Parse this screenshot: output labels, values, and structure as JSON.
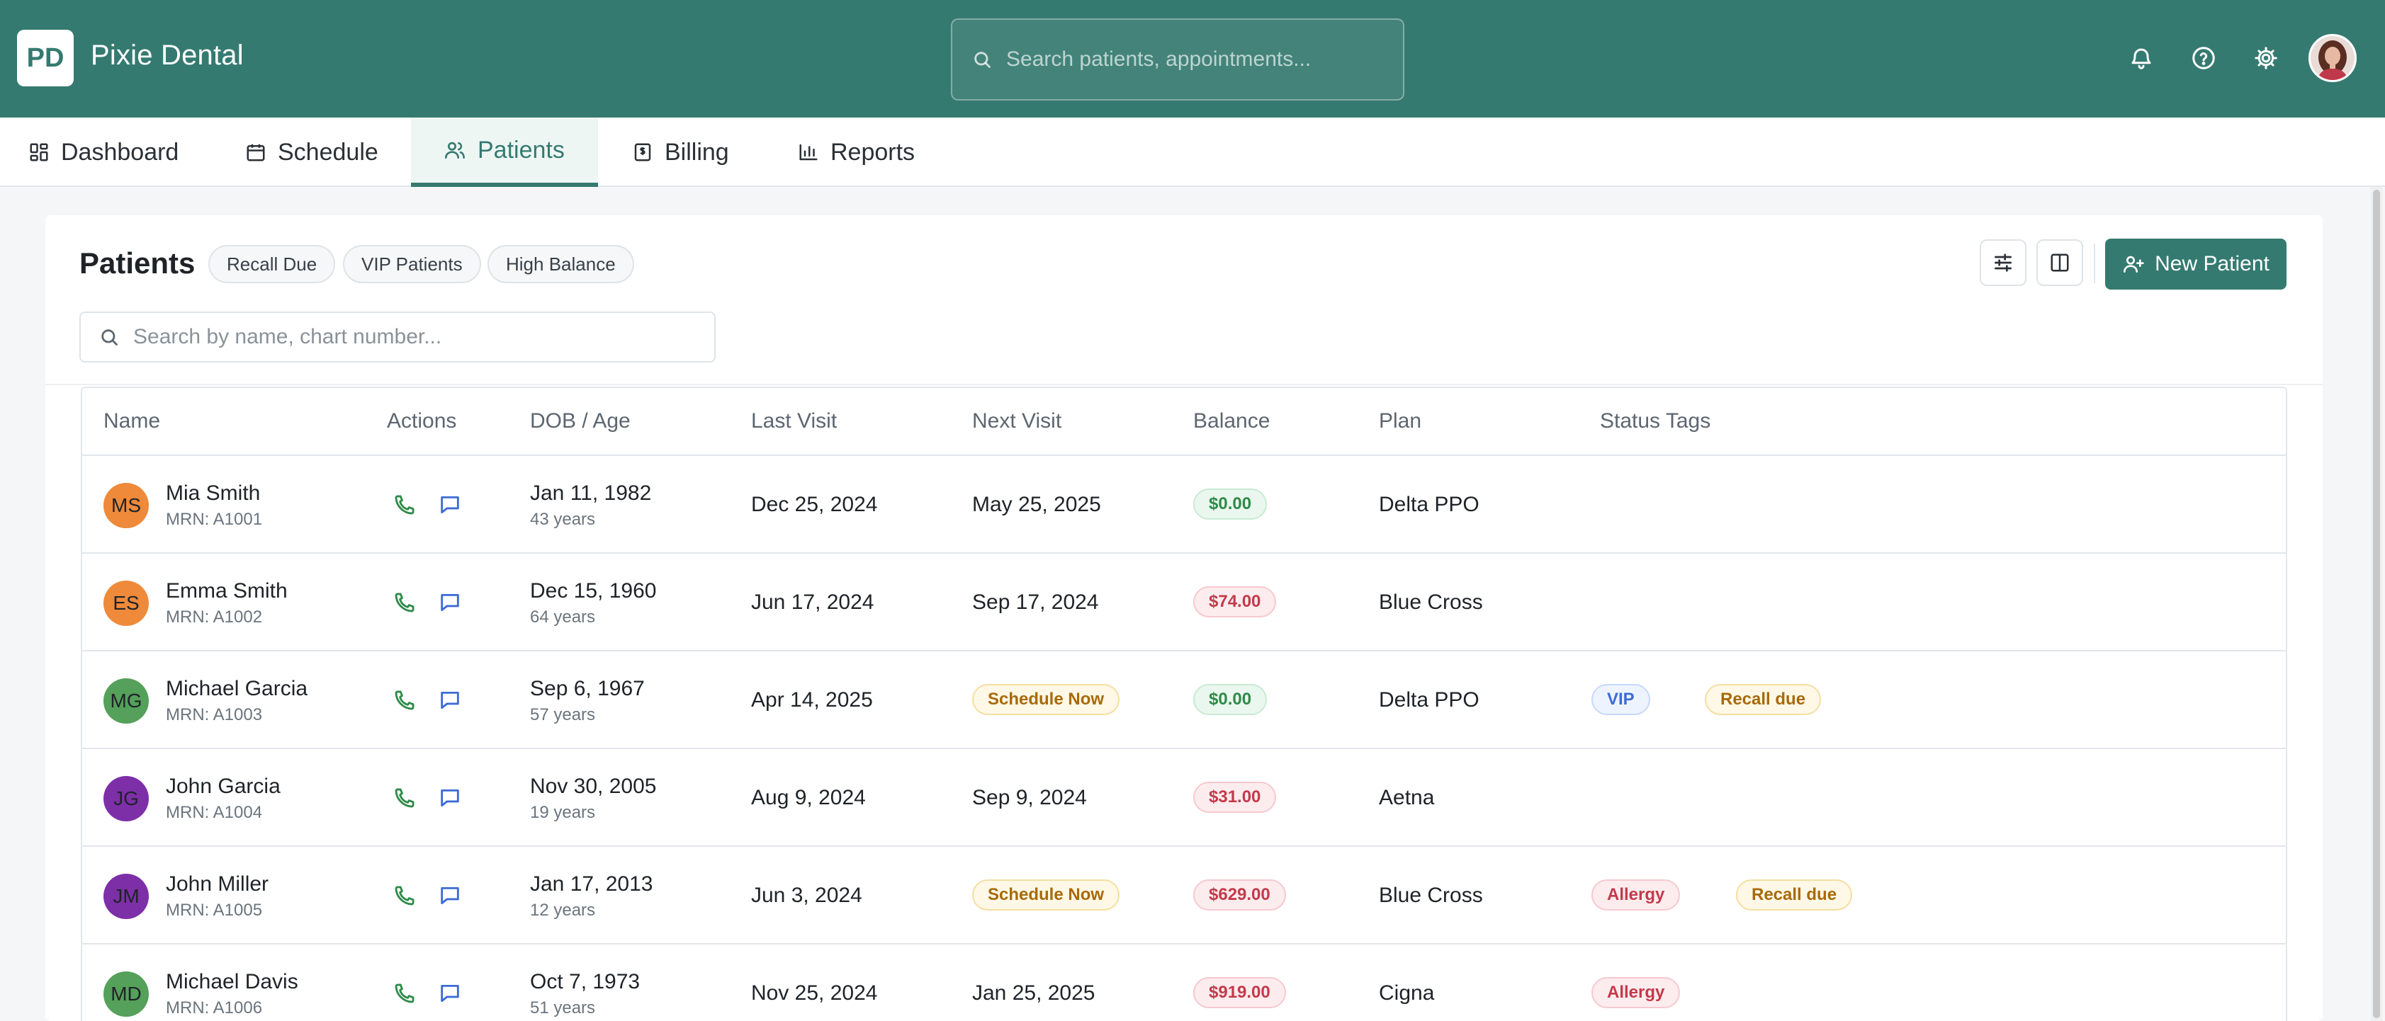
{
  "app": {
    "logo": "PD",
    "name": "Pixie Dental"
  },
  "topbar": {
    "search_placeholder": "Search patients, appointments..."
  },
  "nav": {
    "tabs": [
      {
        "label": "Dashboard",
        "icon": "dashboard-icon"
      },
      {
        "label": "Schedule",
        "icon": "calendar-icon"
      },
      {
        "label": "Patients",
        "icon": "users-icon",
        "active": true
      },
      {
        "label": "Billing",
        "icon": "receipt-icon"
      },
      {
        "label": "Reports",
        "icon": "bar-chart-icon"
      }
    ]
  },
  "page": {
    "title": "Patients",
    "chips": [
      "Recall Due",
      "VIP Patients",
      "High Balance"
    ],
    "new_button": "New Patient",
    "search_placeholder": "Search by name, chart number..."
  },
  "table": {
    "columns": [
      "Name",
      "Actions",
      "DOB / Age",
      "Last Visit",
      "Next Visit",
      "Balance",
      "Plan",
      "Status Tags"
    ],
    "rows": [
      {
        "initials": "MS",
        "name": "Mia Smith",
        "mrn": "MRN: A1001",
        "dob": "Jan 11, 1982",
        "age": "43 years",
        "last": "Dec 25, 2024",
        "next": "May 25, 2025",
        "balance": "$0.00",
        "plan": "Delta PPO",
        "tag1": "",
        "tag2": ""
      },
      {
        "initials": "ES",
        "name": "Emma Smith",
        "mrn": "MRN: A1002",
        "dob": "Dec 15, 1960",
        "age": "64 years",
        "last": "Jun 17, 2024",
        "next": "Sep 17, 2024",
        "balance": "$74.00",
        "plan": "Blue Cross",
        "tag1": "",
        "tag2": ""
      },
      {
        "initials": "MG",
        "name": "Michael Garcia",
        "mrn": "MRN: A1003",
        "dob": "Sep 6, 1967",
        "age": "57 years",
        "last": "Apr 14, 2025",
        "next": "Schedule Now",
        "balance": "$0.00",
        "plan": "Delta PPO",
        "tag1": "VIP",
        "tag2": "Recall due"
      },
      {
        "initials": "JG",
        "name": "John Garcia",
        "mrn": "MRN: A1004",
        "dob": "Nov 30, 2005",
        "age": "19 years",
        "last": "Aug 9, 2024",
        "next": "Sep 9, 2024",
        "balance": "$31.00",
        "plan": "Aetna",
        "tag1": "",
        "tag2": ""
      },
      {
        "initials": "JM",
        "name": "John Miller",
        "mrn": "MRN: A1005",
        "dob": "Jan 17, 2013",
        "age": "12 years",
        "last": "Jun 3, 2024",
        "next": "Schedule Now",
        "balance": "$629.00",
        "plan": "Blue Cross",
        "tag1": "Allergy",
        "tag2": "Recall due"
      },
      {
        "initials": "MD",
        "name": "Michael Davis",
        "mrn": "MRN: A1006",
        "dob": "Oct 7, 1973",
        "age": "51 years",
        "last": "Nov 25, 2024",
        "next": "Jan 25, 2025",
        "balance": "$919.00",
        "plan": "Cigna",
        "tag1": "Allergy",
        "tag2": ""
      }
    ]
  },
  "colors": {
    "brand": "#357a70",
    "avatar_orange": "#ee8a3a",
    "avatar_green": "#55a05a",
    "avatar_purple": "#7d2fa8"
  }
}
